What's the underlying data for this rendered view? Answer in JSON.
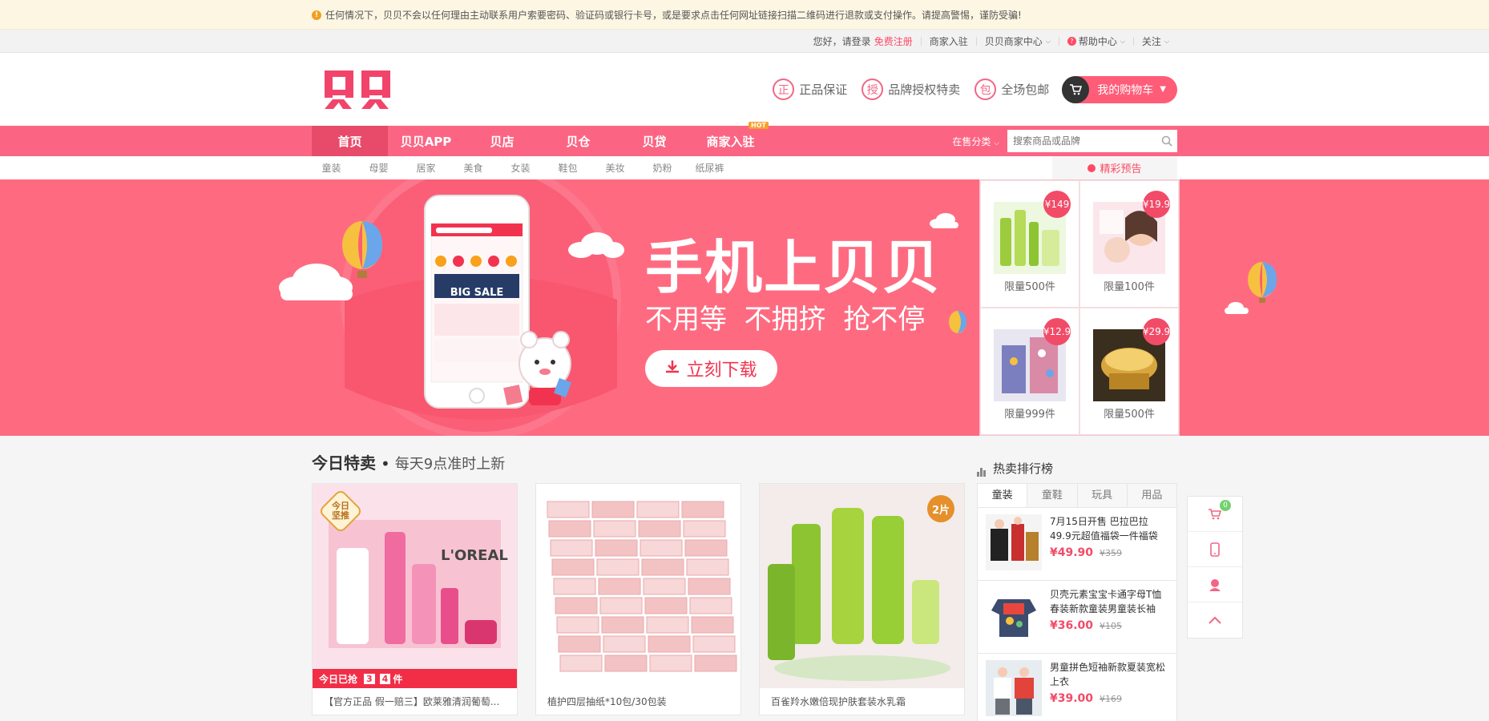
{
  "notice": {
    "text": "任何情况下，贝贝不会以任何理由主动联系用户索要密码、验证码或银行卡号，或是要求点击任何网址链接扫描二维码进行退款或支付操作。请提高警惕，谨防受骗!"
  },
  "topbar": {
    "greeting": "您好，请登录",
    "register": "免费注册",
    "merchant_join": "商家入驻",
    "merchant_center": "贝贝商家中心",
    "help": "帮助中心",
    "follow": "关注"
  },
  "header": {
    "logo_text": "贝贝",
    "promises": [
      {
        "icon": "正",
        "label": "正品保证"
      },
      {
        "icon": "授",
        "label": "品牌授权特卖"
      },
      {
        "icon": "包",
        "label": "全场包邮"
      }
    ],
    "cart_label": "我的购物车"
  },
  "nav": {
    "items": [
      {
        "label": "首页",
        "active": true
      },
      {
        "label": "贝贝APP"
      },
      {
        "label": "贝店"
      },
      {
        "label": "贝仓"
      },
      {
        "label": "贝贷"
      },
      {
        "label": "商家入驻",
        "badge": "HOT"
      }
    ],
    "category_filter": "在售分类",
    "search_placeholder": "搜索商品或品牌"
  },
  "subnav": {
    "items": [
      "童装",
      "母婴",
      "居家",
      "美食",
      "女装",
      "鞋包",
      "美妆",
      "奶粉",
      "纸尿裤"
    ],
    "preview": "精彩预告"
  },
  "banner": {
    "headline": "手机上贝贝",
    "tagline": "不用等  不拥挤  抢不停",
    "download": "立刻下载",
    "phone_big_sale": "BIG SALE"
  },
  "deals": [
    {
      "price": "¥149",
      "limit": "限量500件"
    },
    {
      "price": "¥19.9",
      "limit": "限量100件"
    },
    {
      "price": "¥12.9",
      "limit": "限量999件"
    },
    {
      "price": "¥29.9",
      "limit": "限量500件"
    }
  ],
  "today": {
    "title": "今日特卖",
    "dot": "•",
    "subtitle": "每天9点准时上新",
    "products": [
      {
        "name": "【官方正品 假一赔三】欧莱雅清润葡萄...",
        "seal": "今日\n坚推",
        "bar_prefix": "今日已抢",
        "digit1": "3",
        "digit2": "4",
        "bar_suffix": "件"
      },
      {
        "name": "植护四层抽纸*10包/30包装"
      },
      {
        "name": "百雀羚水嫩倍现护肤套装水乳霜",
        "badge": "2片"
      }
    ]
  },
  "ranking": {
    "title": "热卖排行榜",
    "tabs": [
      "童装",
      "童鞋",
      "玩具",
      "用品"
    ],
    "items": [
      {
        "title": "7月15日开售 巴拉巴拉49.9元超值福袋一件福袋",
        "price": "¥49.90",
        "old": "¥359"
      },
      {
        "title": "贝壳元素宝宝卡通字母T恤春装新款童装男童装长袖",
        "price": "¥36.00",
        "old": "¥105"
      },
      {
        "title": "男童拼色短袖新款夏装宽松上衣",
        "price": "¥39.00",
        "old": "¥169"
      }
    ]
  },
  "floatbar": {
    "cart_count": "0"
  },
  "colors": {
    "brand": "#fb6583",
    "price": "#f24b68",
    "banner_bg": "#fe6b81"
  }
}
